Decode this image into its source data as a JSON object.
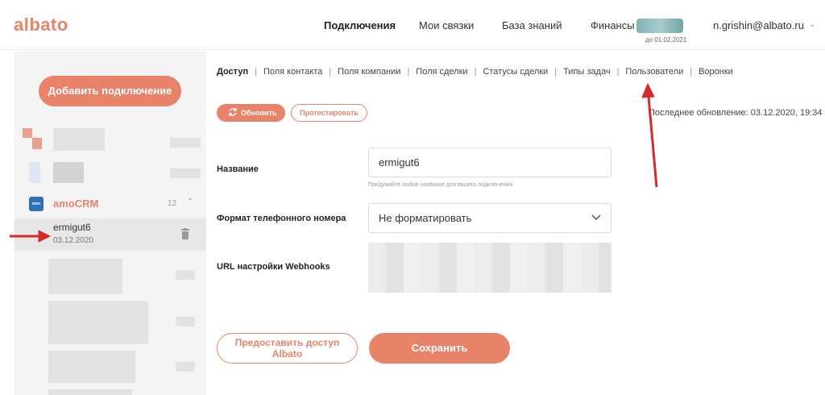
{
  "header": {
    "logo": "albato",
    "nav": [
      "Подключения",
      "Мои связки",
      "База знаний",
      "Финансы"
    ],
    "finance_until": "до 01.02.2021",
    "user": "n.grishin@albato.ru"
  },
  "sidebar": {
    "add_button": "Добавить подключение",
    "group": {
      "name": "amoCRM",
      "count": "12"
    },
    "connection": {
      "name": "ermigut6",
      "date": "03.12.2020"
    }
  },
  "tabs": [
    "Доступ",
    "Поля контакта",
    "Поля компании",
    "Поля сделки",
    "Статусы сделки",
    "Типы задач",
    "Пользователи",
    "Воронки"
  ],
  "toolbar": {
    "refresh": "Обновить",
    "test": "Протестировать",
    "last_update": "Последнее обновление: 03.12.2020, 19:34"
  },
  "form": {
    "name_label": "Название",
    "name_value": "ermigut6",
    "name_hint": "Придумайте любое название для вашего подключения",
    "phone_label": "Формат телефонного номера",
    "phone_value": "Не форматировать",
    "webhook_label": "URL настройки Webhooks"
  },
  "actions": {
    "grant_access_line1": "Предоставить доступ",
    "grant_access_line2": "Albato",
    "save": "Сохранить"
  },
  "colors": {
    "accent": "#e8836a",
    "annotation_arrow": "#d62a2a"
  }
}
